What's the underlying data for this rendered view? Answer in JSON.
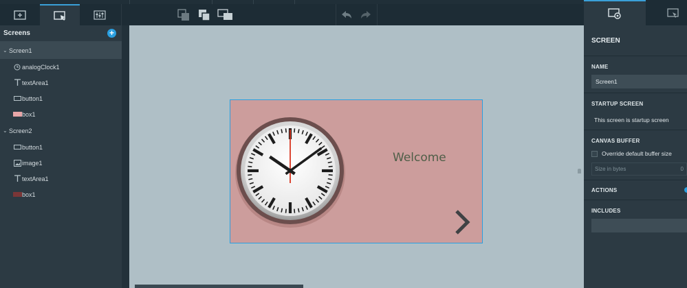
{
  "toolbar": {
    "tabs": [
      {
        "icon": "add-screen-icon",
        "active": false
      },
      {
        "icon": "select-screen-icon",
        "active": true
      },
      {
        "icon": "sliders-icon",
        "active": false
      }
    ],
    "buttons": [
      "send-to-back-icon",
      "bring-to-front-icon",
      "group-icon",
      "undo-icon",
      "redo-icon"
    ]
  },
  "left_panel": {
    "title": "Screens",
    "screens": [
      {
        "name": "Screen1",
        "selected": true,
        "items": [
          {
            "label": "analogClock1",
            "icon": "clock-icon"
          },
          {
            "label": "textArea1",
            "icon": "text-icon"
          },
          {
            "label": "button1",
            "icon": "button-icon"
          },
          {
            "label": "box1",
            "icon": "box-swatch",
            "color": "#e8a6a8"
          }
        ]
      },
      {
        "name": "Screen2",
        "selected": false,
        "items": [
          {
            "label": "button1",
            "icon": "button-icon"
          },
          {
            "label": "image1",
            "icon": "image-icon"
          },
          {
            "label": "textArea1",
            "icon": "text-icon"
          },
          {
            "label": "box1",
            "icon": "box-swatch",
            "color": "#7a3637"
          }
        ]
      }
    ]
  },
  "canvas": {
    "background": "#afbfc6",
    "screen_bg": "#cc9d9c",
    "welcome_text": "Welcome",
    "clock": {
      "hour": 10,
      "minute": 9,
      "second": 0
    }
  },
  "right_panel": {
    "title": "SCREEN",
    "name_label": "NAME",
    "name_value": "Screen1",
    "startup_label": "STARTUP SCREEN",
    "startup_text": "This screen is startup screen",
    "buffer_label": "CANVAS BUFFER",
    "buffer_checkbox_label": "Override default buffer size",
    "buffer_size_placeholder": "Size in bytes",
    "buffer_size_value": "0",
    "actions_label": "ACTIONS",
    "includes_label": "INCLUDES"
  },
  "colors": {
    "accent": "#2a9fe0",
    "panel": "#2c3a43",
    "toolbar": "#1d2c35"
  }
}
